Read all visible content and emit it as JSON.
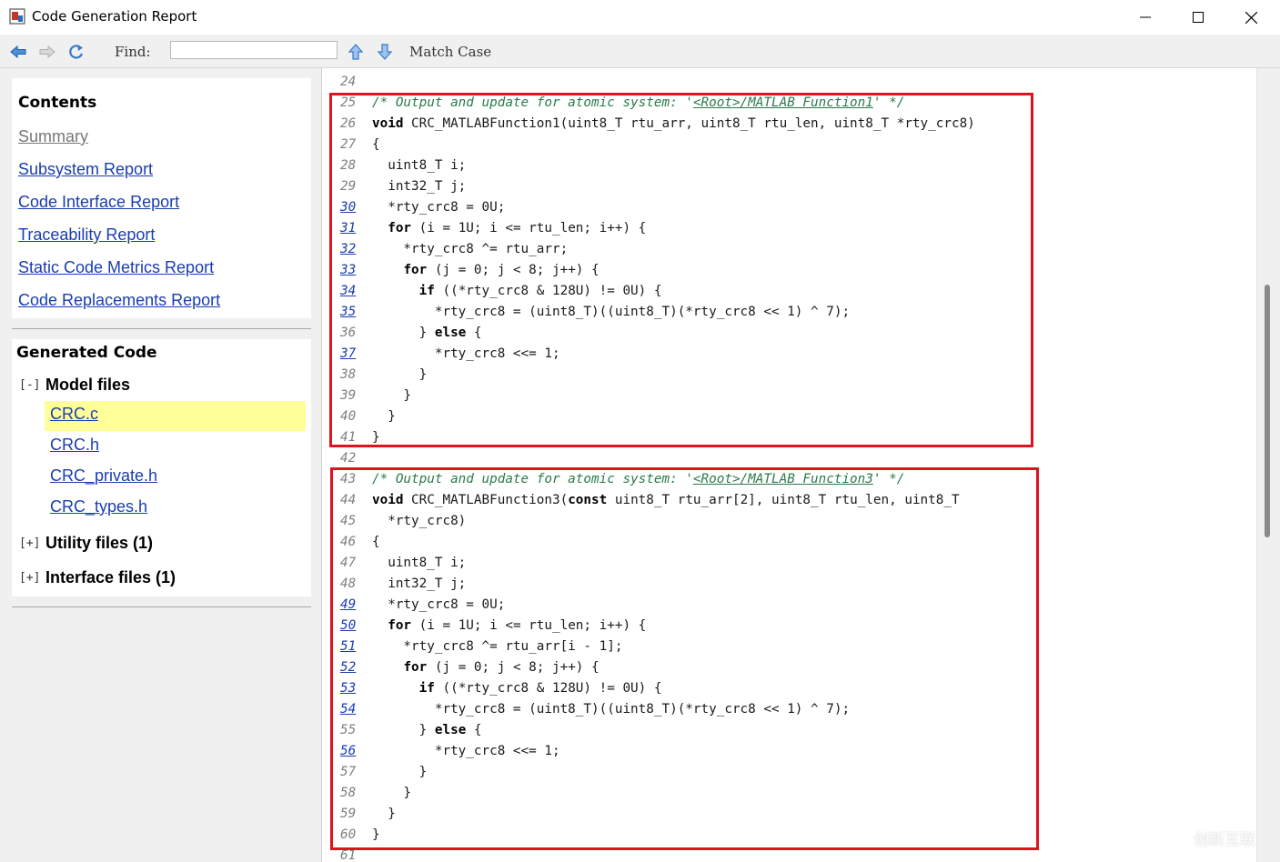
{
  "window": {
    "title": "Code Generation Report"
  },
  "toolbar": {
    "find_label": "Find:",
    "find_value": "",
    "match_case_label": "Match Case"
  },
  "sidebar": {
    "contents_title": "Contents",
    "contents_links": [
      "Summary",
      "Subsystem Report",
      "Code Interface Report",
      "Traceability Report",
      "Static Code Metrics Report",
      "Code Replacements Report"
    ],
    "generated_title": "Generated Code",
    "model_files": {
      "toggle": "[-]",
      "label": "Model files",
      "files": [
        "CRC.c",
        "CRC.h",
        "CRC_private.h",
        "CRC_types.h"
      ]
    },
    "utility_files": {
      "toggle": "[+]",
      "label": "Utility files (1)"
    },
    "interface_files": {
      "toggle": "[+]",
      "label": "Interface files (1)"
    }
  },
  "code": {
    "lines": [
      {
        "n": "24",
        "link": false,
        "html": ""
      },
      {
        "n": "25",
        "link": false,
        "html": "<span class=\"cm\">/* Output and update for atomic system: '</span><span class=\"cmlink\">&lt;Root&gt;/MATLAB Function1</span><span class=\"cm\">' */</span>"
      },
      {
        "n": "26",
        "link": false,
        "html": "<span class=\"kw\">void</span> CRC_MATLABFunction1(uint8_T rtu_arr, uint8_T rtu_len, uint8_T *rty_crc8)"
      },
      {
        "n": "27",
        "link": false,
        "html": "{"
      },
      {
        "n": "28",
        "link": false,
        "html": "  uint8_T i;"
      },
      {
        "n": "29",
        "link": false,
        "html": "  int32_T j;"
      },
      {
        "n": "30",
        "link": true,
        "html": "  *rty_crc8 = 0U;"
      },
      {
        "n": "31",
        "link": true,
        "html": "  <span class=\"kw\">for</span> (i = 1U; i &lt;= rtu_len; i++) {"
      },
      {
        "n": "32",
        "link": true,
        "html": "    *rty_crc8 ^= rtu_arr;"
      },
      {
        "n": "33",
        "link": true,
        "html": "    <span class=\"kw\">for</span> (j = 0; j &lt; 8; j++) {"
      },
      {
        "n": "34",
        "link": true,
        "html": "      <span class=\"kw\">if</span> ((*rty_crc8 &amp; 128U) != 0U) {"
      },
      {
        "n": "35",
        "link": true,
        "html": "        *rty_crc8 = (uint8_T)((uint8_T)(*rty_crc8 &lt;&lt; 1) ^ 7);"
      },
      {
        "n": "36",
        "link": false,
        "html": "      } <span class=\"kw\">else</span> {"
      },
      {
        "n": "37",
        "link": true,
        "html": "        *rty_crc8 &lt;&lt;= 1;"
      },
      {
        "n": "38",
        "link": false,
        "html": "      }"
      },
      {
        "n": "39",
        "link": false,
        "html": "    }"
      },
      {
        "n": "40",
        "link": false,
        "html": "  }"
      },
      {
        "n": "41",
        "link": false,
        "html": "}"
      },
      {
        "n": "42",
        "link": false,
        "html": ""
      },
      {
        "n": "43",
        "link": false,
        "html": "<span class=\"cm\">/* Output and update for atomic system: '</span><span class=\"cmlink\">&lt;Root&gt;/MATLAB Function3</span><span class=\"cm\">' */</span>"
      },
      {
        "n": "44",
        "link": false,
        "html": "<span class=\"kw\">void</span> CRC_MATLABFunction3(<span class=\"kw\">const</span> uint8_T rtu_arr[2], uint8_T rtu_len, uint8_T"
      },
      {
        "n": "45",
        "link": false,
        "html": "  *rty_crc8)"
      },
      {
        "n": "46",
        "link": false,
        "html": "{"
      },
      {
        "n": "47",
        "link": false,
        "html": "  uint8_T i;"
      },
      {
        "n": "48",
        "link": false,
        "html": "  int32_T j;"
      },
      {
        "n": "49",
        "link": true,
        "html": "  *rty_crc8 = 0U;"
      },
      {
        "n": "50",
        "link": true,
        "html": "  <span class=\"kw\">for</span> (i = 1U; i &lt;= rtu_len; i++) {"
      },
      {
        "n": "51",
        "link": true,
        "html": "    *rty_crc8 ^= rtu_arr[i - 1];"
      },
      {
        "n": "52",
        "link": true,
        "html": "    <span class=\"kw\">for</span> (j = 0; j &lt; 8; j++) {"
      },
      {
        "n": "53",
        "link": true,
        "html": "      <span class=\"kw\">if</span> ((*rty_crc8 &amp; 128U) != 0U) {"
      },
      {
        "n": "54",
        "link": true,
        "html": "        *rty_crc8 = (uint8_T)((uint8_T)(*rty_crc8 &lt;&lt; 1) ^ 7);"
      },
      {
        "n": "55",
        "link": false,
        "html": "      } <span class=\"kw\">else</span> {"
      },
      {
        "n": "56",
        "link": true,
        "html": "        *rty_crc8 &lt;&lt;= 1;"
      },
      {
        "n": "57",
        "link": false,
        "html": "      }"
      },
      {
        "n": "58",
        "link": false,
        "html": "    }"
      },
      {
        "n": "59",
        "link": false,
        "html": "  }"
      },
      {
        "n": "60",
        "link": false,
        "html": "}"
      },
      {
        "n": "61",
        "link": false,
        "html": ""
      }
    ]
  },
  "watermark": {
    "text": "创新互联"
  },
  "colors": {
    "highlight_box": "#e0121e",
    "link": "#1a3db0",
    "comment": "#2b7a4b",
    "file_highlight": "#ffff99"
  }
}
